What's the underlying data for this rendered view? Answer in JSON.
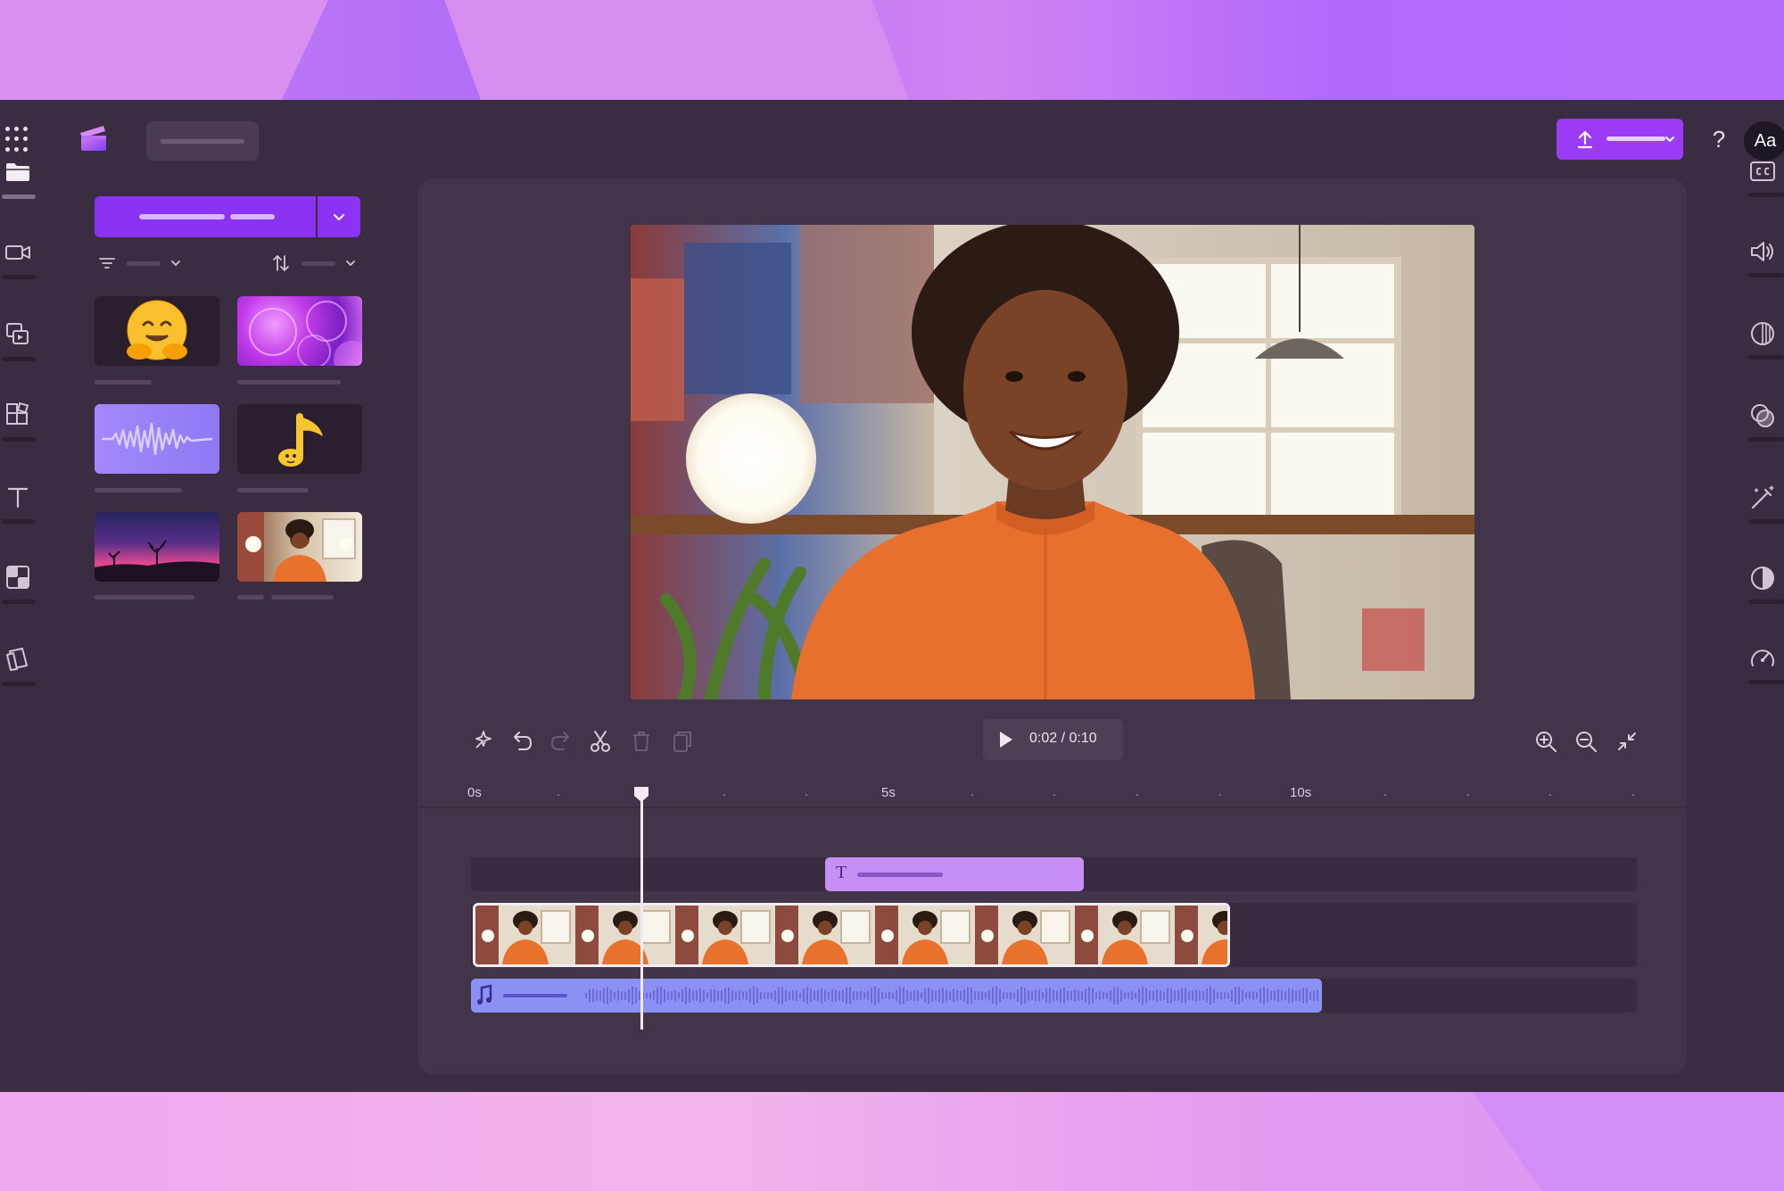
{
  "player": {
    "current_time": "0:02",
    "separator": "/",
    "duration": "0:10"
  },
  "ruler": {
    "labels": [
      "0s",
      "5s",
      "10s"
    ]
  },
  "header": {
    "help_label": "?",
    "account_initials": "Aa"
  },
  "colors": {
    "accent": "#8c32f2",
    "app_bg": "#3b2d41",
    "stage_bg": "#433549",
    "text_clip": "#c58ff6",
    "audio_clip": "#8b91f3"
  },
  "left_rail": {
    "items": [
      "folder-icon",
      "video-camera-icon",
      "media-library-icon",
      "templates-icon",
      "text-icon",
      "transitions-icon",
      "brand-kit-icon"
    ]
  },
  "right_rail": {
    "items": [
      "captions-icon",
      "audio-icon",
      "fade-icon",
      "filters-icon",
      "effects-icon",
      "adjust-colors-icon",
      "speed-icon"
    ]
  },
  "media": {
    "thumbnails": [
      "hugging-face-emoji",
      "purple-bubbles",
      "audio-waveform",
      "music-note-sticker",
      "sunset-landscape",
      "woman-in-orange-sweater"
    ]
  }
}
